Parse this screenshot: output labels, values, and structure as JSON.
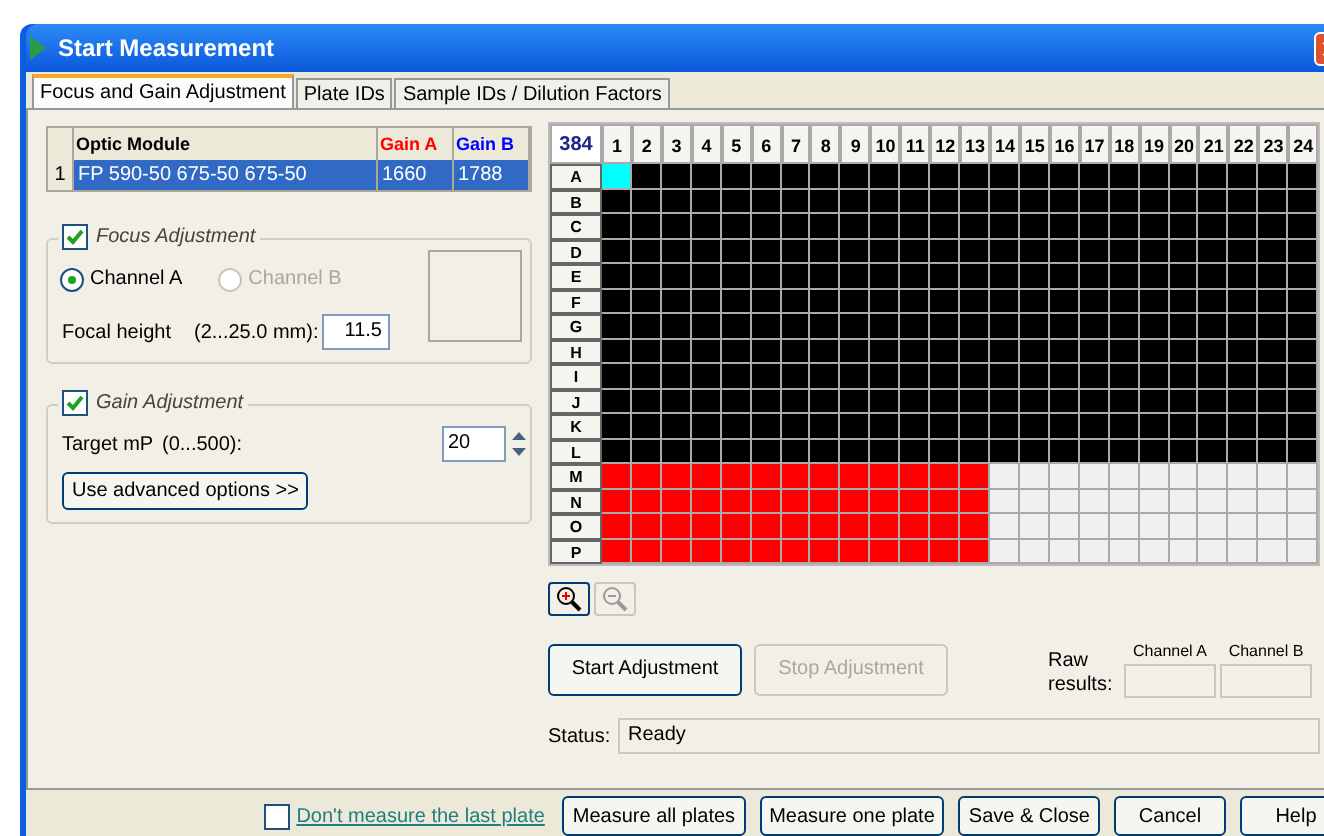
{
  "window": {
    "title": "Start Measurement"
  },
  "tabs": [
    {
      "label": "Focus and Gain Adjustment",
      "selected": true
    },
    {
      "label": "Plate IDs",
      "selected": false
    },
    {
      "label": "Sample IDs / Dilution Factors",
      "selected": false
    }
  ],
  "optic_table": {
    "columns": [
      {
        "label": "Optic Module",
        "color": "#000000"
      },
      {
        "label": "Gain A",
        "color": "#ff0000"
      },
      {
        "label": "Gain B",
        "color": "#0000ff"
      }
    ],
    "rows": [
      {
        "number": "1",
        "cells": [
          "FP 590-50 675-50 675-50",
          "1660",
          "1788"
        ],
        "selected": true
      }
    ]
  },
  "focus": {
    "title": "Focus Adjustment",
    "checked": true,
    "channels": [
      {
        "label": "Channel A",
        "selected": true,
        "disabled": false
      },
      {
        "label": "Channel B",
        "selected": false,
        "disabled": true
      }
    ],
    "height_label": "Focal height",
    "range": "(2...25.0 mm):",
    "value": "11.5"
  },
  "gain": {
    "title": "Gain Adjustment",
    "checked": true,
    "target_label": "Target mP",
    "range": "(0...500):",
    "value": "20",
    "advanced_button": "Use advanced options >>"
  },
  "plate": {
    "format": "384",
    "columns": [
      "1",
      "2",
      "3",
      "4",
      "5",
      "6",
      "7",
      "8",
      "9",
      "10",
      "11",
      "12",
      "13",
      "14",
      "15",
      "16",
      "17",
      "18",
      "19",
      "20",
      "21",
      "22",
      "23",
      "24"
    ],
    "rows": [
      {
        "label": "A",
        "wells": [
          {
            "color": "#00ffff"
          },
          {
            "color": "#000000"
          },
          {
            "color": "#000000"
          },
          {
            "color": "#000000"
          },
          {
            "color": "#000000"
          },
          {
            "color": "#000000"
          },
          {
            "color": "#000000"
          },
          {
            "color": "#000000"
          },
          {
            "color": "#000000"
          },
          {
            "color": "#000000"
          },
          {
            "color": "#000000"
          },
          {
            "color": "#000000"
          },
          {
            "color": "#000000"
          },
          {
            "color": "#000000"
          },
          {
            "color": "#000000"
          },
          {
            "color": "#000000"
          },
          {
            "color": "#000000"
          },
          {
            "color": "#000000"
          },
          {
            "color": "#000000"
          },
          {
            "color": "#000000"
          },
          {
            "color": "#000000"
          },
          {
            "color": "#000000"
          },
          {
            "color": "#000000"
          },
          {
            "color": "#000000"
          }
        ]
      },
      {
        "label": "B",
        "wells": [
          {
            "color": "#000000"
          },
          {
            "color": "#000000"
          },
          {
            "color": "#000000"
          },
          {
            "color": "#000000"
          },
          {
            "color": "#000000"
          },
          {
            "color": "#000000"
          },
          {
            "color": "#000000"
          },
          {
            "color": "#000000"
          },
          {
            "color": "#000000"
          },
          {
            "color": "#000000"
          },
          {
            "color": "#000000"
          },
          {
            "color": "#000000"
          },
          {
            "color": "#000000"
          },
          {
            "color": "#000000"
          },
          {
            "color": "#000000"
          },
          {
            "color": "#000000"
          },
          {
            "color": "#000000"
          },
          {
            "color": "#000000"
          },
          {
            "color": "#000000"
          },
          {
            "color": "#000000"
          },
          {
            "color": "#000000"
          },
          {
            "color": "#000000"
          },
          {
            "color": "#000000"
          },
          {
            "color": "#000000"
          }
        ]
      },
      {
        "label": "C",
        "wells": [
          {
            "color": "#000000"
          },
          {
            "color": "#000000"
          },
          {
            "color": "#000000"
          },
          {
            "color": "#000000"
          },
          {
            "color": "#000000"
          },
          {
            "color": "#000000"
          },
          {
            "color": "#000000"
          },
          {
            "color": "#000000"
          },
          {
            "color": "#000000"
          },
          {
            "color": "#000000"
          },
          {
            "color": "#000000"
          },
          {
            "color": "#000000"
          },
          {
            "color": "#000000"
          },
          {
            "color": "#000000"
          },
          {
            "color": "#000000"
          },
          {
            "color": "#000000"
          },
          {
            "color": "#000000"
          },
          {
            "color": "#000000"
          },
          {
            "color": "#000000"
          },
          {
            "color": "#000000"
          },
          {
            "color": "#000000"
          },
          {
            "color": "#000000"
          },
          {
            "color": "#000000"
          },
          {
            "color": "#000000"
          }
        ]
      },
      {
        "label": "D",
        "wells": [
          {
            "color": "#000000"
          },
          {
            "color": "#000000"
          },
          {
            "color": "#000000"
          },
          {
            "color": "#000000"
          },
          {
            "color": "#000000"
          },
          {
            "color": "#000000"
          },
          {
            "color": "#000000"
          },
          {
            "color": "#000000"
          },
          {
            "color": "#000000"
          },
          {
            "color": "#000000"
          },
          {
            "color": "#000000"
          },
          {
            "color": "#000000"
          },
          {
            "color": "#000000"
          },
          {
            "color": "#000000"
          },
          {
            "color": "#000000"
          },
          {
            "color": "#000000"
          },
          {
            "color": "#000000"
          },
          {
            "color": "#000000"
          },
          {
            "color": "#000000"
          },
          {
            "color": "#000000"
          },
          {
            "color": "#000000"
          },
          {
            "color": "#000000"
          },
          {
            "color": "#000000"
          },
          {
            "color": "#000000"
          }
        ]
      },
      {
        "label": "E",
        "wells": [
          {
            "color": "#000000"
          },
          {
            "color": "#000000"
          },
          {
            "color": "#000000"
          },
          {
            "color": "#000000"
          },
          {
            "color": "#000000"
          },
          {
            "color": "#000000"
          },
          {
            "color": "#000000"
          },
          {
            "color": "#000000"
          },
          {
            "color": "#000000"
          },
          {
            "color": "#000000"
          },
          {
            "color": "#000000"
          },
          {
            "color": "#000000"
          },
          {
            "color": "#000000"
          },
          {
            "color": "#000000"
          },
          {
            "color": "#000000"
          },
          {
            "color": "#000000"
          },
          {
            "color": "#000000"
          },
          {
            "color": "#000000"
          },
          {
            "color": "#000000"
          },
          {
            "color": "#000000"
          },
          {
            "color": "#000000"
          },
          {
            "color": "#000000"
          },
          {
            "color": "#000000"
          },
          {
            "color": "#000000"
          }
        ]
      },
      {
        "label": "F",
        "wells": [
          {
            "color": "#000000"
          },
          {
            "color": "#000000"
          },
          {
            "color": "#000000"
          },
          {
            "color": "#000000"
          },
          {
            "color": "#000000"
          },
          {
            "color": "#000000"
          },
          {
            "color": "#000000"
          },
          {
            "color": "#000000"
          },
          {
            "color": "#000000"
          },
          {
            "color": "#000000"
          },
          {
            "color": "#000000"
          },
          {
            "color": "#000000"
          },
          {
            "color": "#000000"
          },
          {
            "color": "#000000"
          },
          {
            "color": "#000000"
          },
          {
            "color": "#000000"
          },
          {
            "color": "#000000"
          },
          {
            "color": "#000000"
          },
          {
            "color": "#000000"
          },
          {
            "color": "#000000"
          },
          {
            "color": "#000000"
          },
          {
            "color": "#000000"
          },
          {
            "color": "#000000"
          },
          {
            "color": "#000000"
          }
        ]
      },
      {
        "label": "G",
        "wells": [
          {
            "color": "#000000"
          },
          {
            "color": "#000000"
          },
          {
            "color": "#000000"
          },
          {
            "color": "#000000"
          },
          {
            "color": "#000000"
          },
          {
            "color": "#000000"
          },
          {
            "color": "#000000"
          },
          {
            "color": "#000000"
          },
          {
            "color": "#000000"
          },
          {
            "color": "#000000"
          },
          {
            "color": "#000000"
          },
          {
            "color": "#000000"
          },
          {
            "color": "#000000"
          },
          {
            "color": "#000000"
          },
          {
            "color": "#000000"
          },
          {
            "color": "#000000"
          },
          {
            "color": "#000000"
          },
          {
            "color": "#000000"
          },
          {
            "color": "#000000"
          },
          {
            "color": "#000000"
          },
          {
            "color": "#000000"
          },
          {
            "color": "#000000"
          },
          {
            "color": "#000000"
          },
          {
            "color": "#000000"
          }
        ]
      },
      {
        "label": "H",
        "wells": [
          {
            "color": "#000000"
          },
          {
            "color": "#000000"
          },
          {
            "color": "#000000"
          },
          {
            "color": "#000000"
          },
          {
            "color": "#000000"
          },
          {
            "color": "#000000"
          },
          {
            "color": "#000000"
          },
          {
            "color": "#000000"
          },
          {
            "color": "#000000"
          },
          {
            "color": "#000000"
          },
          {
            "color": "#000000"
          },
          {
            "color": "#000000"
          },
          {
            "color": "#000000"
          },
          {
            "color": "#000000"
          },
          {
            "color": "#000000"
          },
          {
            "color": "#000000"
          },
          {
            "color": "#000000"
          },
          {
            "color": "#000000"
          },
          {
            "color": "#000000"
          },
          {
            "color": "#000000"
          },
          {
            "color": "#000000"
          },
          {
            "color": "#000000"
          },
          {
            "color": "#000000"
          },
          {
            "color": "#000000"
          }
        ]
      },
      {
        "label": "I",
        "wells": [
          {
            "color": "#000000"
          },
          {
            "color": "#000000"
          },
          {
            "color": "#000000"
          },
          {
            "color": "#000000"
          },
          {
            "color": "#000000"
          },
          {
            "color": "#000000"
          },
          {
            "color": "#000000"
          },
          {
            "color": "#000000"
          },
          {
            "color": "#000000"
          },
          {
            "color": "#000000"
          },
          {
            "color": "#000000"
          },
          {
            "color": "#000000"
          },
          {
            "color": "#000000"
          },
          {
            "color": "#000000"
          },
          {
            "color": "#000000"
          },
          {
            "color": "#000000"
          },
          {
            "color": "#000000"
          },
          {
            "color": "#000000"
          },
          {
            "color": "#000000"
          },
          {
            "color": "#000000"
          },
          {
            "color": "#000000"
          },
          {
            "color": "#000000"
          },
          {
            "color": "#000000"
          },
          {
            "color": "#000000"
          }
        ]
      },
      {
        "label": "J",
        "wells": [
          {
            "color": "#000000"
          },
          {
            "color": "#000000"
          },
          {
            "color": "#000000"
          },
          {
            "color": "#000000"
          },
          {
            "color": "#000000"
          },
          {
            "color": "#000000"
          },
          {
            "color": "#000000"
          },
          {
            "color": "#000000"
          },
          {
            "color": "#000000"
          },
          {
            "color": "#000000"
          },
          {
            "color": "#000000"
          },
          {
            "color": "#000000"
          },
          {
            "color": "#000000"
          },
          {
            "color": "#000000"
          },
          {
            "color": "#000000"
          },
          {
            "color": "#000000"
          },
          {
            "color": "#000000"
          },
          {
            "color": "#000000"
          },
          {
            "color": "#000000"
          },
          {
            "color": "#000000"
          },
          {
            "color": "#000000"
          },
          {
            "color": "#000000"
          },
          {
            "color": "#000000"
          },
          {
            "color": "#000000"
          }
        ]
      },
      {
        "label": "K",
        "wells": [
          {
            "color": "#000000"
          },
          {
            "color": "#000000"
          },
          {
            "color": "#000000"
          },
          {
            "color": "#000000"
          },
          {
            "color": "#000000"
          },
          {
            "color": "#000000"
          },
          {
            "color": "#000000"
          },
          {
            "color": "#000000"
          },
          {
            "color": "#000000"
          },
          {
            "color": "#000000"
          },
          {
            "color": "#000000"
          },
          {
            "color": "#000000"
          },
          {
            "color": "#000000"
          },
          {
            "color": "#000000"
          },
          {
            "color": "#000000"
          },
          {
            "color": "#000000"
          },
          {
            "color": "#000000"
          },
          {
            "color": "#000000"
          },
          {
            "color": "#000000"
          },
          {
            "color": "#000000"
          },
          {
            "color": "#000000"
          },
          {
            "color": "#000000"
          },
          {
            "color": "#000000"
          },
          {
            "color": "#000000"
          }
        ]
      },
      {
        "label": "L",
        "wells": [
          {
            "color": "#000000"
          },
          {
            "color": "#000000"
          },
          {
            "color": "#000000"
          },
          {
            "color": "#000000"
          },
          {
            "color": "#000000"
          },
          {
            "color": "#000000"
          },
          {
            "color": "#000000"
          },
          {
            "color": "#000000"
          },
          {
            "color": "#000000"
          },
          {
            "color": "#000000"
          },
          {
            "color": "#000000"
          },
          {
            "color": "#000000"
          },
          {
            "color": "#000000"
          },
          {
            "color": "#000000"
          },
          {
            "color": "#000000"
          },
          {
            "color": "#000000"
          },
          {
            "color": "#000000"
          },
          {
            "color": "#000000"
          },
          {
            "color": "#000000"
          },
          {
            "color": "#000000"
          },
          {
            "color": "#000000"
          },
          {
            "color": "#000000"
          },
          {
            "color": "#000000"
          },
          {
            "color": "#000000"
          }
        ]
      },
      {
        "label": "M",
        "wells": [
          {
            "color": "#ff0000"
          },
          {
            "color": "#ff0000"
          },
          {
            "color": "#ff0000"
          },
          {
            "color": "#ff0000"
          },
          {
            "color": "#ff0000"
          },
          {
            "color": "#ff0000"
          },
          {
            "color": "#ff0000"
          },
          {
            "color": "#ff0000"
          },
          {
            "color": "#ff0000"
          },
          {
            "color": "#ff0000"
          },
          {
            "color": "#ff0000"
          },
          {
            "color": "#ff0000"
          },
          {
            "color": "#ff0000"
          },
          {
            "color": "#f0f0f0"
          },
          {
            "color": "#f0f0f0"
          },
          {
            "color": "#f0f0f0"
          },
          {
            "color": "#f0f0f0"
          },
          {
            "color": "#f0f0f0"
          },
          {
            "color": "#f0f0f0"
          },
          {
            "color": "#f0f0f0"
          },
          {
            "color": "#f0f0f0"
          },
          {
            "color": "#f0f0f0"
          },
          {
            "color": "#f0f0f0"
          },
          {
            "color": "#f0f0f0"
          }
        ]
      },
      {
        "label": "N",
        "wells": [
          {
            "color": "#ff0000"
          },
          {
            "color": "#ff0000"
          },
          {
            "color": "#ff0000"
          },
          {
            "color": "#ff0000"
          },
          {
            "color": "#ff0000"
          },
          {
            "color": "#ff0000"
          },
          {
            "color": "#ff0000"
          },
          {
            "color": "#ff0000"
          },
          {
            "color": "#ff0000"
          },
          {
            "color": "#ff0000"
          },
          {
            "color": "#ff0000"
          },
          {
            "color": "#ff0000"
          },
          {
            "color": "#ff0000"
          },
          {
            "color": "#f0f0f0"
          },
          {
            "color": "#f0f0f0"
          },
          {
            "color": "#f0f0f0"
          },
          {
            "color": "#f0f0f0"
          },
          {
            "color": "#f0f0f0"
          },
          {
            "color": "#f0f0f0"
          },
          {
            "color": "#f0f0f0"
          },
          {
            "color": "#f0f0f0"
          },
          {
            "color": "#f0f0f0"
          },
          {
            "color": "#f0f0f0"
          },
          {
            "color": "#f0f0f0"
          }
        ]
      },
      {
        "label": "O",
        "wells": [
          {
            "color": "#ff0000"
          },
          {
            "color": "#ff0000"
          },
          {
            "color": "#ff0000"
          },
          {
            "color": "#ff0000"
          },
          {
            "color": "#ff0000"
          },
          {
            "color": "#ff0000"
          },
          {
            "color": "#ff0000"
          },
          {
            "color": "#ff0000"
          },
          {
            "color": "#ff0000"
          },
          {
            "color": "#ff0000"
          },
          {
            "color": "#ff0000"
          },
          {
            "color": "#ff0000"
          },
          {
            "color": "#ff0000"
          },
          {
            "color": "#f0f0f0"
          },
          {
            "color": "#f0f0f0"
          },
          {
            "color": "#f0f0f0"
          },
          {
            "color": "#f0f0f0"
          },
          {
            "color": "#f0f0f0"
          },
          {
            "color": "#f0f0f0"
          },
          {
            "color": "#f0f0f0"
          },
          {
            "color": "#f0f0f0"
          },
          {
            "color": "#f0f0f0"
          },
          {
            "color": "#f0f0f0"
          },
          {
            "color": "#f0f0f0"
          }
        ]
      },
      {
        "label": "P",
        "wells": [
          {
            "color": "#ff0000"
          },
          {
            "color": "#ff0000"
          },
          {
            "color": "#ff0000"
          },
          {
            "color": "#ff0000"
          },
          {
            "color": "#ff0000"
          },
          {
            "color": "#ff0000"
          },
          {
            "color": "#ff0000"
          },
          {
            "color": "#ff0000"
          },
          {
            "color": "#ff0000"
          },
          {
            "color": "#ff0000"
          },
          {
            "color": "#ff0000"
          },
          {
            "color": "#ff0000"
          },
          {
            "color": "#ff0000"
          },
          {
            "color": "#f0f0f0"
          },
          {
            "color": "#f0f0f0"
          },
          {
            "color": "#f0f0f0"
          },
          {
            "color": "#f0f0f0"
          },
          {
            "color": "#f0f0f0"
          },
          {
            "color": "#f0f0f0"
          },
          {
            "color": "#f0f0f0"
          },
          {
            "color": "#f0f0f0"
          },
          {
            "color": "#f0f0f0"
          },
          {
            "color": "#f0f0f0"
          },
          {
            "color": "#f0f0f0"
          }
        ]
      }
    ]
  },
  "zoom_buttons": [
    {
      "kind": "zoom-in",
      "disabled": false
    },
    {
      "kind": "zoom-out",
      "disabled": true
    }
  ],
  "adjust_buttons": [
    {
      "label": "Start Adjustment",
      "disabled": false
    },
    {
      "label": "Stop Adjustment",
      "disabled": true
    }
  ],
  "raw_results": {
    "label": "Raw results:",
    "channels": [
      "Channel A",
      "Channel B"
    ]
  },
  "status": {
    "label": "Status:",
    "value": "Ready"
  },
  "footer": {
    "skip_last": {
      "label": "Don't measure the last plate",
      "checked": false
    },
    "buttons": [
      "Measure all plates",
      "Measure one plate",
      "Save & Close",
      "Cancel",
      "Help"
    ]
  }
}
